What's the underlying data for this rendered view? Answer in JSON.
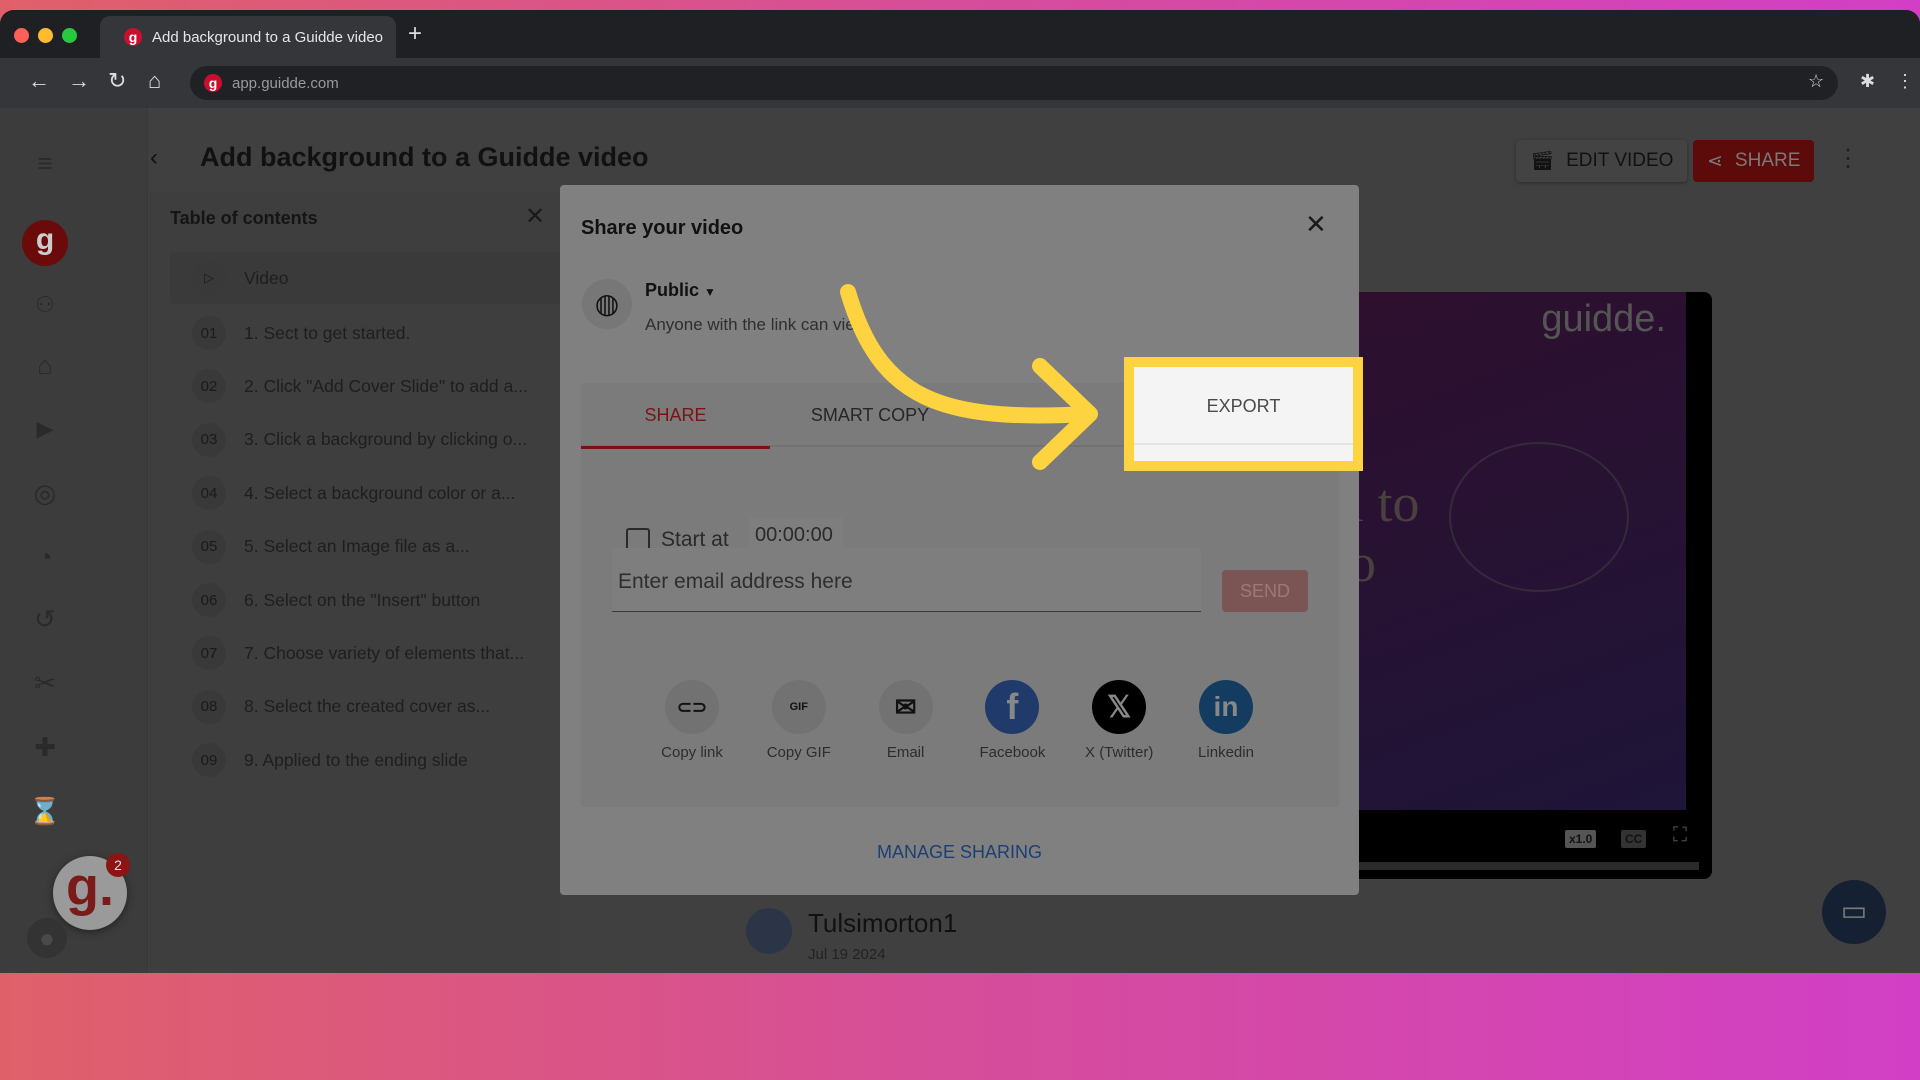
{
  "browser": {
    "tab_title": "Add background to a Guidde video",
    "url": "app.guidde.com",
    "new_tab": "+"
  },
  "header": {
    "title": "Add background to a Guidde video",
    "edit_video": "EDIT VIDEO",
    "share": "SHARE"
  },
  "toc": {
    "title": "Table of contents",
    "video_label": "Video",
    "items": [
      {
        "num": "01",
        "label": "1. Sect to get started."
      },
      {
        "num": "02",
        "label": "2. Click \"Add Cover Slide\" to add a..."
      },
      {
        "num": "03",
        "label": "3. Click a background by clicking o..."
      },
      {
        "num": "04",
        "label": "4. Select a background color or a..."
      },
      {
        "num": "05",
        "label": "5. Select an Image file as a..."
      },
      {
        "num": "06",
        "label": "6. Select on the \"Insert\" button"
      },
      {
        "num": "07",
        "label": "7. Choose variety of elements that..."
      },
      {
        "num": "08",
        "label": "8. Select the created cover as..."
      },
      {
        "num": "09",
        "label": "9. Applied to the ending slide"
      }
    ]
  },
  "modal": {
    "title": "Share your video",
    "visibility": "Public",
    "visibility_desc": "Anyone with the link can view",
    "tabs": [
      {
        "label": "SHARE",
        "active": true
      },
      {
        "label": "SMART COPY"
      },
      {
        "label": "EXPORT",
        "highlighted": true
      }
    ],
    "start_at_label": "Start at",
    "start_at_value": "00:00:00",
    "start_at_checked": false,
    "email_placeholder": "Enter email address here",
    "send": "SEND",
    "share_options": [
      {
        "label": "Copy link",
        "icon": "link-icon"
      },
      {
        "label": "Copy GIF",
        "icon": "gif-icon"
      },
      {
        "label": "Email",
        "icon": "mail-icon"
      },
      {
        "label": "Facebook",
        "icon": "facebook-icon"
      },
      {
        "label": "X (Twitter)",
        "icon": "x-icon"
      },
      {
        "label": "Linkedin",
        "icon": "linkedin-icon"
      }
    ],
    "manage_sharing": "MANAGE SHARING"
  },
  "player": {
    "brand": "guidde.",
    "speed": "x1.0",
    "cc": "CC",
    "slide_text_1": "l to",
    "slide_text_2": "o"
  },
  "author": {
    "name": "Tulsimorton1",
    "date": "Jul 19 2024"
  },
  "badge": {
    "count": "2"
  },
  "colors": {
    "highlight": "#fdd33f",
    "accent": "#c8102e"
  }
}
